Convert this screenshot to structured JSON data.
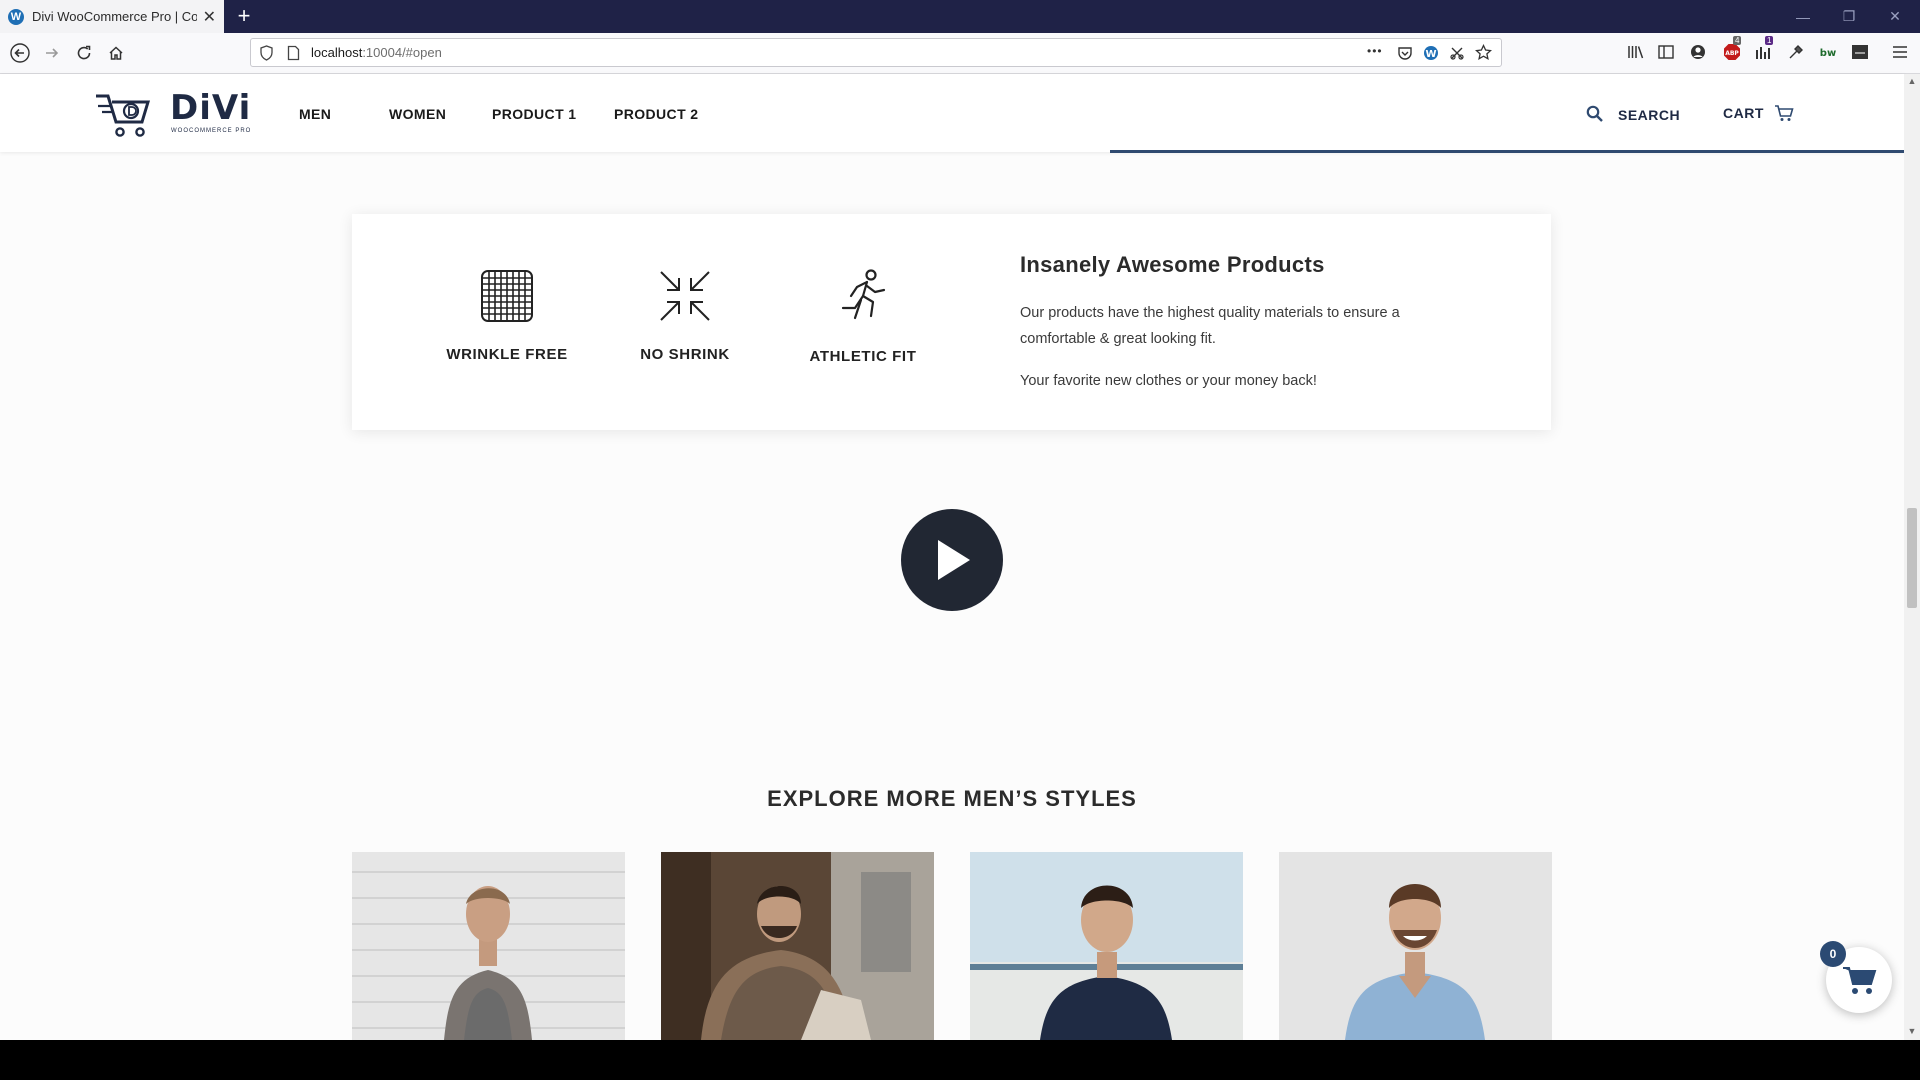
{
  "browser": {
    "tab_title": "Divi WooCommerce Pro | Com",
    "new_tab_symbol": "+",
    "tab_close_symbol": "✕",
    "url_host": "localhost",
    "url_rest": ":10004/#open",
    "url_menu_dots": "•••",
    "window_minimize": "—",
    "window_restore": "❐",
    "window_close": "✕",
    "ext_badge_1": "4",
    "ext_badge_2": "1",
    "wp_letter": "W"
  },
  "site": {
    "logo_text": "DiVi",
    "logo_sub": "WOOCOMMERCE PRO",
    "menu": [
      "MEN",
      "WOMEN",
      "PRODUCT 1",
      "PRODUCT 2"
    ],
    "search_label": "SEARCH",
    "cart_label": "CART"
  },
  "features": {
    "items": [
      {
        "label": "WRINKLE FREE",
        "icon": "grid-fabric-icon"
      },
      {
        "label": "NO SHRINK",
        "icon": "compress-arrows-icon"
      },
      {
        "label": "ATHLETIC FIT",
        "icon": "runner-icon"
      }
    ],
    "title": "Insanely Awesome Products",
    "text": "Our products have the highest quality materials to ensure a comfortable & great looking fit.",
    "text2": "Your favorite new clothes or your money back!"
  },
  "video": {
    "icon": "play-icon"
  },
  "explore": {
    "title": "EXPLORE MORE MEN’S STYLES",
    "photos": [
      "man-tank-top-photo",
      "man-printed-shirt-photo",
      "man-polo-photo",
      "man-denim-shirt-photo"
    ]
  },
  "floating_cart": {
    "count": "0"
  },
  "colors": {
    "brand_dark": "#1f2a44",
    "accent": "#2f4a70",
    "tabstrip": "#1f2247"
  }
}
